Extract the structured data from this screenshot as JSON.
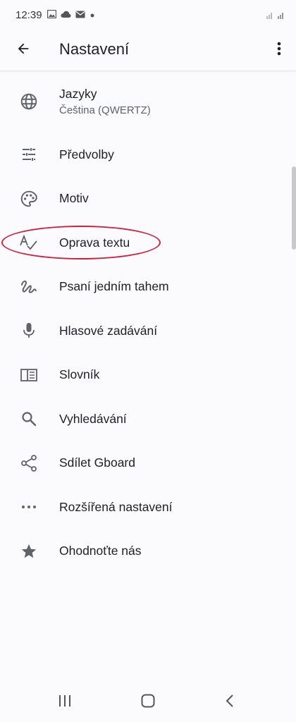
{
  "status_bar": {
    "time": "12:39",
    "icons": [
      "image-icon",
      "cloud-icon",
      "mail-icon",
      "dot-icon"
    ],
    "right_icons": [
      "wifi-signal-icon",
      "cell-signal-icon"
    ]
  },
  "app_bar": {
    "title": "Nastavení",
    "back_icon": "arrow-back-icon",
    "more_icon": "more-vert-icon"
  },
  "settings": {
    "items": [
      {
        "label": "Jazyky",
        "sublabel": "Čeština (QWERTZ)",
        "icon": "globe-icon"
      },
      {
        "label": "Předvolby",
        "icon": "tune-icon"
      },
      {
        "label": "Motiv",
        "icon": "palette-icon"
      },
      {
        "label": "Oprava textu",
        "icon": "spellcheck-icon",
        "highlighted": true
      },
      {
        "label": "Psaní jedním tahem",
        "icon": "gesture-icon"
      },
      {
        "label": "Hlasové zadávání",
        "icon": "mic-icon"
      },
      {
        "label": "Slovník",
        "icon": "dictionary-icon"
      },
      {
        "label": "Vyhledávání",
        "icon": "search-icon"
      },
      {
        "label": "Sdílet Gboard",
        "icon": "share-icon"
      },
      {
        "label": "Rozšířená nastavení",
        "icon": "more-horiz-icon"
      },
      {
        "label": "Ohodnoťte nás",
        "icon": "star-icon"
      }
    ]
  },
  "colors": {
    "background": "#fbfbfd",
    "icon": "#5f6368",
    "highlight_ring": "#d21f3c"
  },
  "nav_bar": {
    "recents_icon": "recents-icon",
    "home_icon": "home-icon",
    "back_icon": "nav-back-icon"
  }
}
